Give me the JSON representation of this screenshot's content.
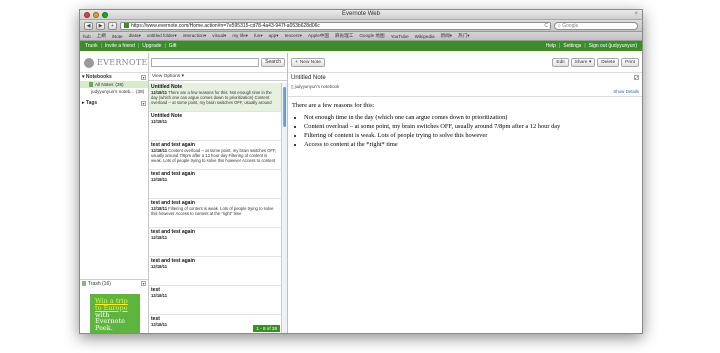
{
  "browser": {
    "window_title": "Evernote Web",
    "url": "https://www.evernote.com/Home.action#n=7e595315-cd78-4a43-947f-a053b628d06c",
    "search_placeholder": "Google",
    "back": "◀",
    "forward": "▶",
    "add": "+",
    "reload": "C",
    "bookmarks": [
      "hub",
      "上網",
      "iNote",
      "dlata▾",
      "untitled folder▾",
      "interaction▾",
      "visual▾",
      "my life▾",
      "fun▾",
      "app▾",
      "tencent▾",
      "Apple中国",
      "麻省理工",
      "Google 地图",
      "YouTube",
      "Wikipedia",
      "新闻▾",
      "热门▾"
    ]
  },
  "topnav": {
    "left": [
      "Trunk",
      "Invite a friend",
      "Upgrade",
      "Gift"
    ],
    "right": [
      "Help",
      "Settings",
      "Sign out (judyyunyun)"
    ]
  },
  "logo": "EVERNOTE",
  "sidebar": {
    "notebooks_label": "Notebooks",
    "notebooks": [
      {
        "label": "All Notes",
        "count": "(38)"
      },
      {
        "label": "judyyunyun's noteb...",
        "count": "(38)"
      }
    ],
    "tags_label": "Tags",
    "trash_label": "Trash",
    "trash_count": "(16)",
    "promo": [
      "Win a trip",
      "to Europe",
      "with",
      "Evernote",
      "Peek."
    ]
  },
  "notelist": {
    "search_button": "Search",
    "view_options": "View Options ▾",
    "counter": "1 - 8 of 38",
    "notes": [
      {
        "title": "Untitled Note",
        "date": "12/18/11",
        "preview": "There are a few reasons for this: Not enough time in the day (which one can argue comes down to prioritization) Content overload -- at some point, my brain switches OFF, usually around"
      },
      {
        "title": "Untitled Note",
        "date": "12/18/11",
        "preview": ""
      },
      {
        "title": "test and test again",
        "date": "12/18/11",
        "preview": "Content overload -- at some point, my brain switches OFF, usually around 7/8pm after a 12 hour day Filtering of content is weak. Lots of people trying to solve this however Access to content"
      },
      {
        "title": "test and test again",
        "date": "12/18/11",
        "preview": ""
      },
      {
        "title": "test and test again",
        "date": "12/18/11",
        "preview": "Filtering of content is weak. Lots of people trying to solve this however Access to content at the \"right\" time"
      },
      {
        "title": "test and test again",
        "date": "12/18/11",
        "preview": ""
      },
      {
        "title": "test and test again",
        "date": "12/18/11",
        "preview": ""
      },
      {
        "title": "test",
        "date": "12/18/11",
        "preview": ""
      },
      {
        "title": "test",
        "date": "12/18/11",
        "preview": ""
      }
    ]
  },
  "note": {
    "new_note": "New Note",
    "buttons": [
      "Edit",
      "Share",
      "Delete",
      "Print"
    ],
    "title": "Untitled Note",
    "notebook": "judyyunyun's notebook",
    "show_details": "Show Details",
    "intro": "There are a few reasons for this:",
    "bullets": [
      "Not enough time in the day (which one can argue comes down to prioritization)",
      "Content overload – at some point, my brain switches OFF, usually around 7/8pm after a 12 hour day",
      "Filtering of content is weak.  Lots of people trying to solve this however",
      "Access to content at the *right* time"
    ]
  },
  "colors": {
    "brand_green": "#3d8c2c",
    "promo_green": "#5fb33f",
    "promo_highlight": "#f6f02a",
    "selected_bg": "#e6f1df"
  }
}
